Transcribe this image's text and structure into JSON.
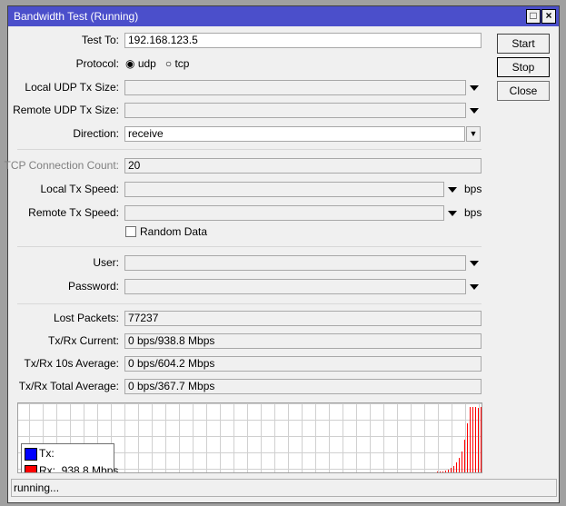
{
  "window": {
    "title": "Bandwidth Test (Running)",
    "maximize_icon": "maximize-icon",
    "close_icon": "close-icon"
  },
  "buttons": {
    "start": "Start",
    "stop": "Stop",
    "close": "Close"
  },
  "form": {
    "test_to": {
      "label": "Test To:",
      "value": "192.168.123.5"
    },
    "protocol": {
      "label": "Protocol:",
      "options": [
        "udp",
        "tcp"
      ],
      "selected": "udp"
    },
    "local_udp_tx_size": {
      "label": "Local UDP Tx Size:",
      "value": ""
    },
    "remote_udp_tx_size": {
      "label": "Remote UDP Tx Size:",
      "value": ""
    },
    "direction": {
      "label": "Direction:",
      "value": "receive"
    },
    "tcp_connection_count": {
      "label": "TCP Connection Count:",
      "value": "20"
    },
    "local_tx_speed": {
      "label": "Local Tx Speed:",
      "value": "",
      "unit": "bps"
    },
    "remote_tx_speed": {
      "label": "Remote Tx Speed:",
      "value": "",
      "unit": "bps"
    },
    "random_data": {
      "label": "Random Data",
      "checked": false
    },
    "user": {
      "label": "User:",
      "value": ""
    },
    "password": {
      "label": "Password:",
      "value": ""
    }
  },
  "stats": {
    "lost_packets": {
      "label": "Lost Packets:",
      "value": "77237"
    },
    "current": {
      "label": "Tx/Rx Current:",
      "value": "0 bps/938.8 Mbps"
    },
    "avg10": {
      "label": "Tx/Rx 10s Average:",
      "value": "0 bps/604.2 Mbps"
    },
    "total_avg": {
      "label": "Tx/Rx Total Average:",
      "value": "0 bps/367.7 Mbps"
    }
  },
  "graph": {
    "tx_color": "#0000ff",
    "rx_color": "#ff0000",
    "legend": {
      "tx": "Tx:",
      "rx": "Rx:  938.8 Mbps"
    },
    "rx_fraction": [
      0.01,
      0.02,
      0.02,
      0.03,
      0.04,
      0.07,
      0.1,
      0.15,
      0.22,
      0.32,
      0.5,
      0.75,
      1,
      1,
      1,
      0.98,
      1
    ]
  },
  "status": "running..."
}
